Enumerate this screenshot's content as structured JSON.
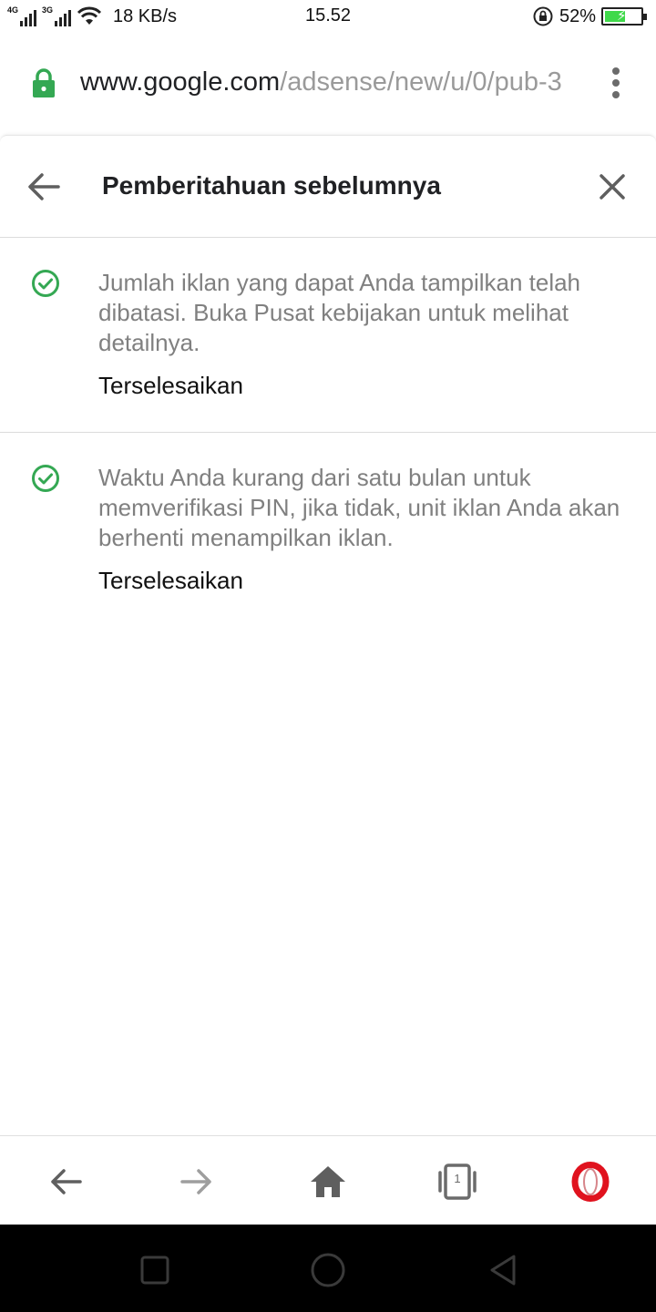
{
  "status_bar": {
    "network_1": "4G",
    "network_2": "3G",
    "speed": "18 KB/s",
    "time": "15.52",
    "battery_percent": "52%",
    "battery_level": 0.52
  },
  "url_bar": {
    "host": "www.google.com",
    "path": "/adsense/new/u/0/pub-3"
  },
  "panel": {
    "title": "Pemberitahuan sebelumnya",
    "notices": [
      {
        "text": "Jumlah iklan yang dapat Anda tampilkan telah dibatasi. Buka Pusat kebijakan untuk melihat detailnya.",
        "status": "Terselesaikan"
      },
      {
        "text": "Waktu Anda kurang dari satu bulan untuk memverifikasi PIN, jika tidak, unit iklan Anda akan berhenti menampilkan iklan.",
        "status": "Terselesaikan"
      }
    ]
  },
  "browser_nav": {
    "tab_count": "1"
  },
  "colors": {
    "accent_green": "#34a853",
    "opera_red": "#e0121e",
    "icon_gray": "#6b6b6b"
  }
}
